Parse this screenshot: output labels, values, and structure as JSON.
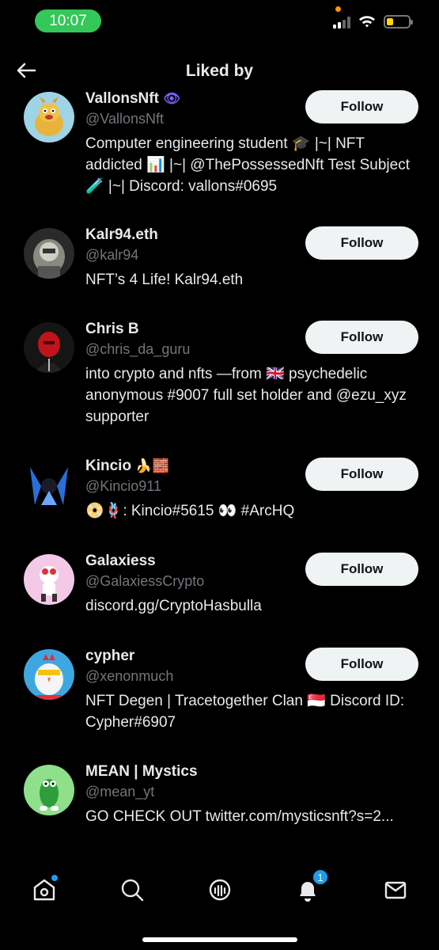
{
  "status_bar": {
    "time": "10:07"
  },
  "header": {
    "title": "Liked by"
  },
  "users": [
    {
      "name": "VallonsNft",
      "name_suffix": "👁",
      "handle": "@VallonsNft",
      "bio": "Computer engineering student 🎓 |~| NFT addicted 📊 |~| @ThePossessedNft Test Subject 🧪 |~| Discord: vallons#0695",
      "button": "Follow"
    },
    {
      "name": "Kalr94.eth",
      "name_suffix": "",
      "handle": "@kalr94",
      "bio": "NFT’s 4 Life! Kalr94.eth",
      "button": "Follow"
    },
    {
      "name": "Chris B",
      "name_suffix": "",
      "handle": "@chris_da_guru",
      "bio": "into crypto and nfts —from 🇬🇧 psychedelic anonymous #9007 full set holder and @ezu_xyz supporter",
      "button": "Follow"
    },
    {
      "name": "Kincio",
      "name_suffix": "🍌🧱",
      "handle": "@Kincio911",
      "bio": "📀🪢: Kincio#5615 👀 #ArcHQ",
      "button": "Follow"
    },
    {
      "name": "Galaxiess",
      "name_suffix": "",
      "handle": "@GalaxiessCrypto",
      "bio": "discord.gg/CryptoHasbulla",
      "button": "Follow"
    },
    {
      "name": "cypher",
      "name_suffix": "",
      "handle": "@xenonmuch",
      "bio": "NFT Degen | Tracetogether Clan 🇸🇬 Discord ID: Cypher#6907",
      "button": "Follow"
    },
    {
      "name": "MEAN | Mystics",
      "name_suffix": "",
      "handle": "@mean_yt",
      "bio": "GO CHECK OUT twitter.com/mysticsnft?s=2...",
      "button": ""
    }
  ],
  "bottom_nav": {
    "items": [
      "home-icon",
      "search-icon",
      "spaces-icon",
      "notifications-icon",
      "messages-icon"
    ],
    "notification_count": "1"
  },
  "colors": {
    "follow_bg": "#eff3f4",
    "accent": "#1d9bf0",
    "muted": "#71767b"
  }
}
